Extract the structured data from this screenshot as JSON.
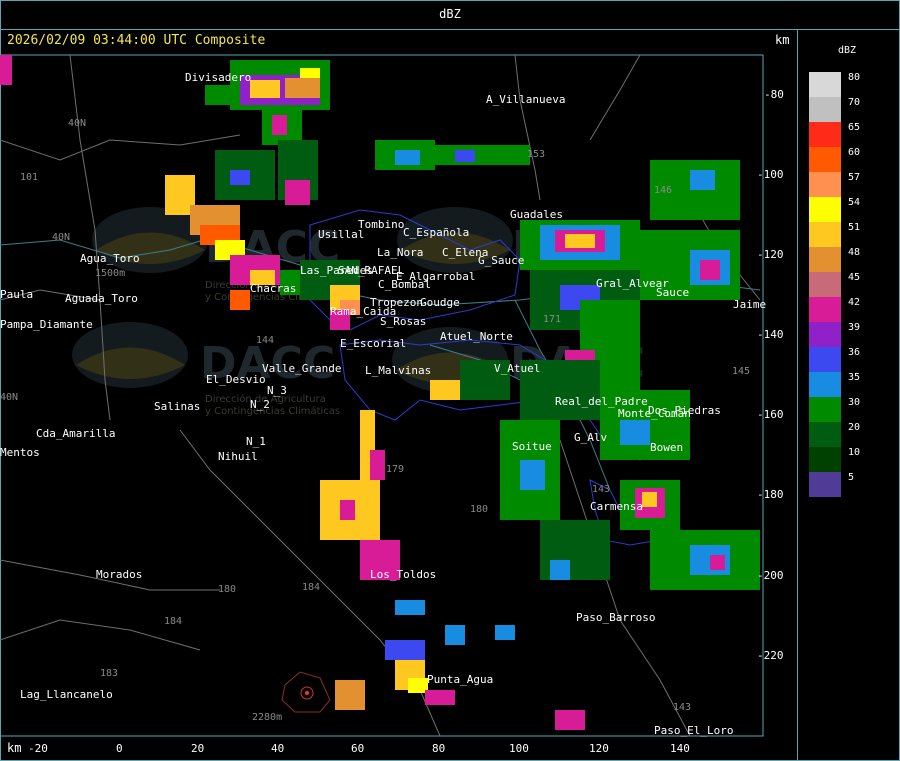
{
  "header": {
    "title": "dBZ"
  },
  "map": {
    "timestamp": "2026/02/09 03:44:00 UTC Composite",
    "km_label_top": "km",
    "km_label_bottom": "km",
    "x_ticks": [
      "-20",
      "0",
      "20",
      "40",
      "60",
      "80",
      "100",
      "120",
      "140"
    ],
    "y_ticks": [
      "-80",
      "-100",
      "-120",
      "-140",
      "-160",
      "-180",
      "-200",
      "-220"
    ],
    "places": [
      "Divisadero",
      "A_Villanueva",
      "Usillal",
      "Tombino",
      "C_Española",
      "La_Nora",
      "C_Elena",
      "Guadales",
      "SAN_RAFAEL",
      "E_Algarrobal",
      "C_Bombal",
      "Tropezon",
      "Goudge",
      "S_Rosas",
      "Atuel_Norte",
      "E_Escorial",
      "L_Malvinas",
      "V_Atuel",
      "Valle_Grande",
      "El_Desvio",
      "Salinas",
      "N_3",
      "N_2",
      "N_1",
      "Nihuil",
      "Cda_Amarilla",
      "Soitue",
      "G_Alv",
      "Real_del_Padre",
      "Monte_Comán",
      "Aguada_Toro",
      "Pampa_Diamante",
      "Agua_Toro",
      "Los_Toldos",
      "Morados",
      "Paso_Barroso",
      "Punta_Agua",
      "Lag_Llancanelo",
      "Paso_El_Loro",
      "Carmensa",
      "Bowen",
      "Gral_Alvear",
      "Sauce",
      "Jaime",
      "Rama_Caida",
      "G_Sauce",
      "Chacras",
      "Mentos",
      "Paula",
      "Dos_Piedras",
      "Las_Paredes"
    ],
    "road_labels": [
      "40N",
      "40N",
      "101",
      "153",
      "146",
      "144",
      "171",
      "179",
      "180",
      "184",
      "183",
      "184",
      "180",
      "143",
      "145",
      "143",
      "2280m",
      "1500m",
      "40N"
    ],
    "watermark": {
      "brand": "DACC",
      "line1": "Dirección de Agricultura",
      "line2": "y Contingencias Climáticas"
    }
  },
  "legend": {
    "title": "dBZ",
    "levels": [
      {
        "value": "80",
        "color": "#d8d8d8"
      },
      {
        "value": "70",
        "color": "#c0c0c0"
      },
      {
        "value": "65",
        "color": "#ff2a18"
      },
      {
        "value": "60",
        "color": "#ff5a00"
      },
      {
        "value": "57",
        "color": "#ff9050"
      },
      {
        "value": "54",
        "color": "#ffff00"
      },
      {
        "value": "51",
        "color": "#ffc820"
      },
      {
        "value": "48",
        "color": "#e39030"
      },
      {
        "value": "45",
        "color": "#c86a78"
      },
      {
        "value": "42",
        "color": "#d81c98"
      },
      {
        "value": "39",
        "color": "#9020c8"
      },
      {
        "value": "36",
        "color": "#3c48f0"
      },
      {
        "value": "35",
        "color": "#188ce0"
      },
      {
        "value": "30",
        "color": "#008a00"
      },
      {
        "value": "20",
        "color": "#005c10"
      },
      {
        "value": "10",
        "color": "#004000"
      },
      {
        "value": "5",
        "color": "#503c96"
      }
    ]
  }
}
